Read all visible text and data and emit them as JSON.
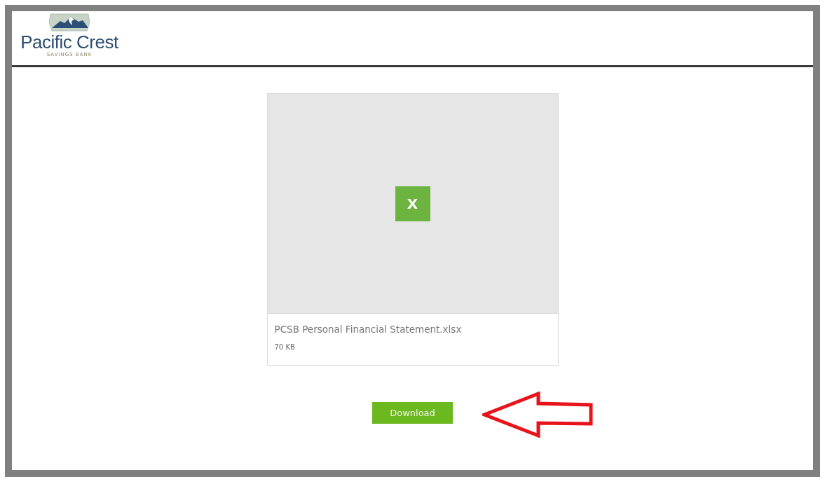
{
  "header": {
    "logo_name": "Pacific Crest",
    "logo_tagline": "SAVINGS BANK"
  },
  "file": {
    "icon_letter": "X",
    "name": "PCSB Personal Financial Statement.xlsx",
    "size": "70 KB"
  },
  "download_button": "Download"
}
